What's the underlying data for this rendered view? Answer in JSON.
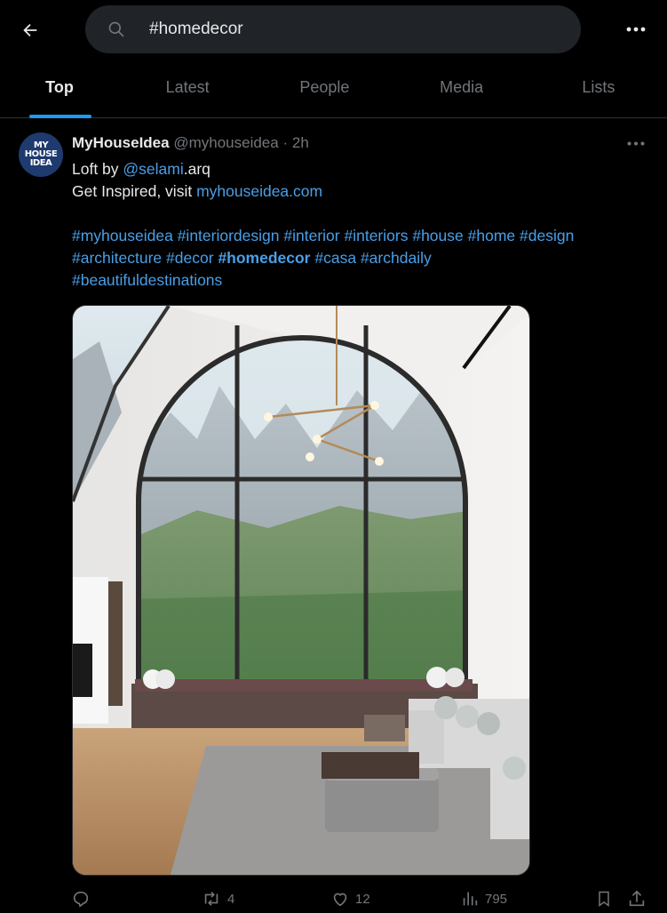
{
  "search": {
    "query": "#homedecor"
  },
  "tabs": [
    "Top",
    "Latest",
    "People",
    "Media",
    "Lists"
  ],
  "tweet": {
    "author_name": "MyHouseIdea",
    "handle": "@myhouseidea",
    "separator": "·",
    "time": "2h",
    "avatar_lines": [
      "MY",
      "HOUSE",
      "IDEA"
    ],
    "line1_prefix": "Loft by ",
    "mention": "@selami",
    "line1_suffix": ".arq",
    "line2_prefix": "Get Inspired, visit ",
    "url": "myhouseidea.com",
    "hashtags_line1": [
      "#myhouseidea",
      "#interiordesign",
      "#interior",
      "#interiors",
      "#house",
      "#home",
      "#design"
    ],
    "hashtags_line2_a": [
      "#architecture",
      "#decor"
    ],
    "hashtag_bold": "#homedecor",
    "hashtags_line2_b": [
      "#casa",
      "#archdaily"
    ],
    "hashtags_line3": [
      "#beautifuldestinations"
    ]
  },
  "actions": {
    "reply_count": "",
    "retweet_count": "4",
    "like_count": "12",
    "views_count": "795"
  },
  "colors": {
    "accent": "#1d9bf0",
    "link": "#4a9fe8",
    "muted": "#71767b",
    "search_bg": "#202327"
  },
  "icons": [
    "back-arrow-icon",
    "search-icon",
    "more-icon",
    "reply-icon",
    "retweet-icon",
    "heart-icon",
    "views-icon",
    "bookmark-icon",
    "share-icon"
  ]
}
